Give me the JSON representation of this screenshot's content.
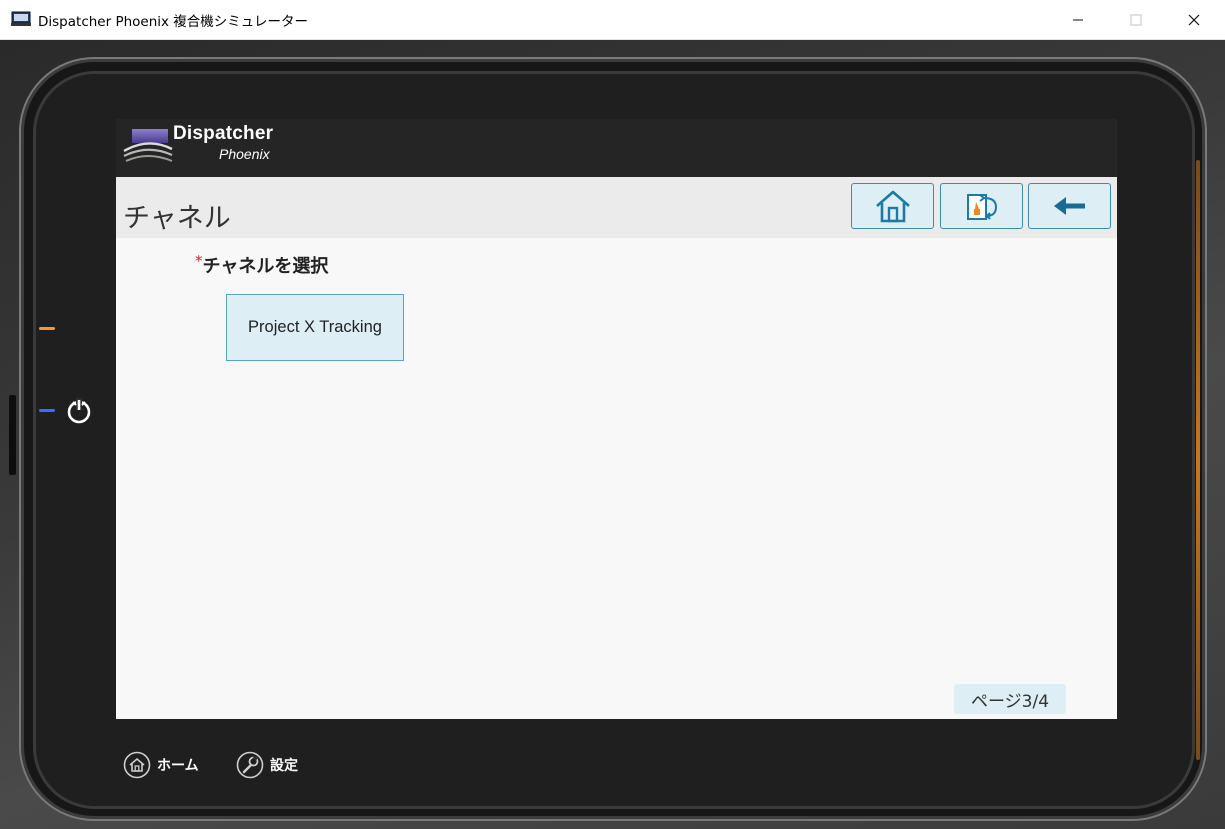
{
  "window": {
    "title": "Dispatcher Phoenix 複合機シミュレーター",
    "icon": "monitor-icon",
    "controls": {
      "minimize": "minimize-icon",
      "maximize": "maximize-icon",
      "close": "close-icon"
    }
  },
  "device": {
    "power_icon": "power-icon",
    "led_colors": {
      "top": "#f39a2b",
      "bottom": "#3a6cff"
    }
  },
  "screen": {
    "logo": {
      "line1": "Dispatcher",
      "line2": "Phoenix"
    },
    "title": "チャネル",
    "nav_buttons": [
      {
        "name": "home",
        "icon": "home-icon"
      },
      {
        "name": "switch",
        "icon": "switch-app-icon"
      },
      {
        "name": "back",
        "icon": "back-arrow-icon"
      }
    ],
    "field": {
      "required_mark": "*",
      "label": "チャネルを選択"
    },
    "channels": [
      {
        "label": "Project X Tracking"
      }
    ],
    "page_indicator": "ページ3/4"
  },
  "bottom_bar": {
    "home_label": "ホーム",
    "settings_label": "設定"
  },
  "colors": {
    "button_fill": "#ddeef4",
    "button_border": "#3c8cb0",
    "header_dark": "#252525",
    "accent_blue": "#1a7aa8"
  }
}
